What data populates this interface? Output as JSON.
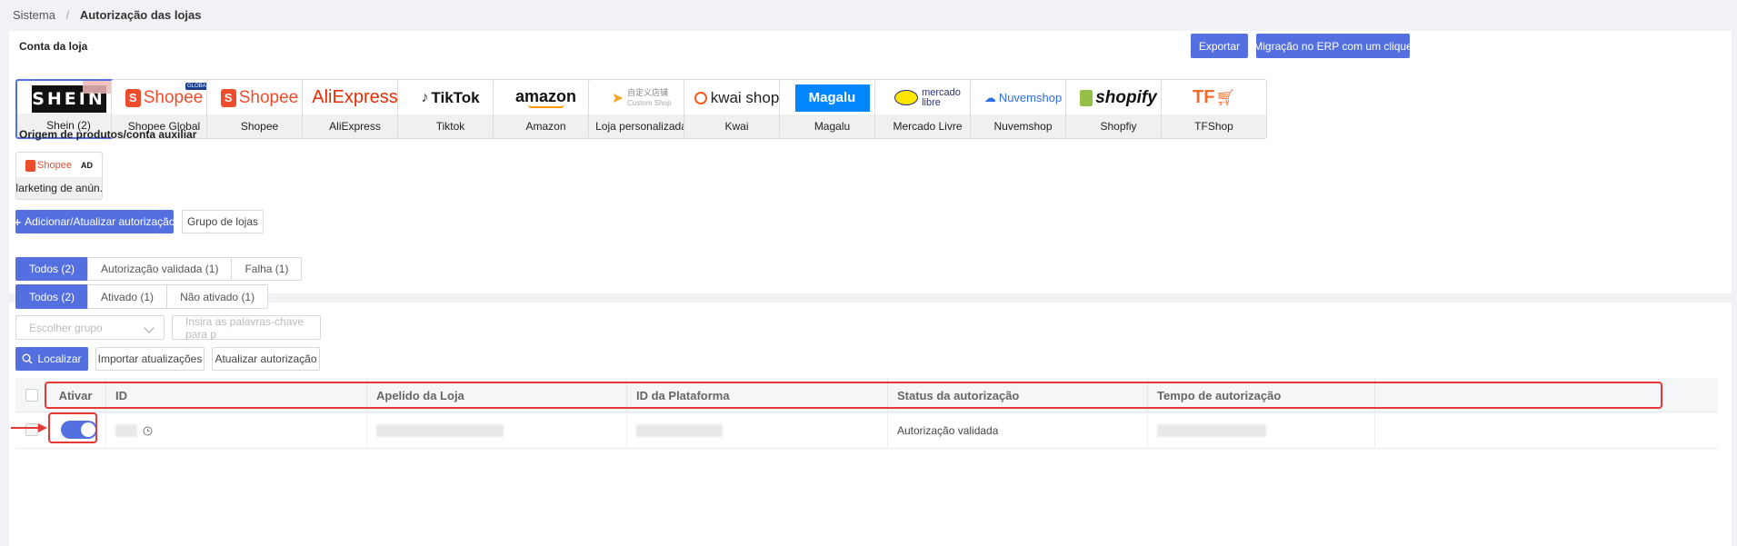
{
  "breadcrumb": {
    "root": "Sistema",
    "separator": "/",
    "current": "Autorização das lojas"
  },
  "store_section": {
    "title": "Conta da loja",
    "export_label": "Exportar",
    "migrate_label": "Migração no ERP com um clique",
    "stores": [
      {
        "label": "Shein (2)",
        "logo": "SHEIN"
      },
      {
        "label": "Shopee Global",
        "logo": "Shopee",
        "badge": "GLOBAL"
      },
      {
        "label": "Shopee",
        "logo": "Shopee"
      },
      {
        "label": "AliExpress",
        "logo": "AliExpress"
      },
      {
        "label": "Tiktok",
        "logo": "TikTok"
      },
      {
        "label": "Amazon",
        "logo": "amazon"
      },
      {
        "label": "Loja personalizada",
        "logo": "自定义店铺",
        "logo_sub": "Custom Shop"
      },
      {
        "label": "Kwai",
        "logo": "kwai shop"
      },
      {
        "label": "Magalu",
        "logo": "Magalu"
      },
      {
        "label": "Mercado Livre",
        "logo": "mercado",
        "logo_sub": "libre"
      },
      {
        "label": "Nuvemshop",
        "logo": "Nuvemshop"
      },
      {
        "label": "Shopfiy",
        "logo": "shopify"
      },
      {
        "label": "TFShop",
        "logo": "TF"
      }
    ],
    "aux_title": "Origem de produtos/conta auxiliar",
    "aux_store": {
      "label": "Marketing de anún...",
      "logo": "Shopee",
      "badge": "AD"
    },
    "add_label": "Adicionar/Atualizar autorização",
    "group_label": "Grupo de lojas"
  },
  "filters": {
    "auth_tabs": [
      "Todos (2)",
      "Autorização validada (1)",
      "Falha (1)"
    ],
    "active_tabs": [
      "Todos (2)",
      "Ativado (1)",
      "Não ativado (1)"
    ],
    "group_placeholder": "Escolher grupo",
    "keyword_placeholder": "Insira as palavras-chave para p",
    "search_label": "Localizar",
    "import_label": "Importar atualizações",
    "refresh_label": "Atualizar autorização"
  },
  "table": {
    "columns": [
      "Ativar",
      "ID",
      "Apelido da Loja",
      "ID da Plataforma",
      "Status da autorização",
      "Tempo de autorização"
    ],
    "rows": [
      {
        "active": true,
        "status": "Autorização validada"
      }
    ]
  },
  "colors": {
    "primary": "#5470e0",
    "highlight": "#e53935",
    "shopee": "#ee4d2d"
  }
}
